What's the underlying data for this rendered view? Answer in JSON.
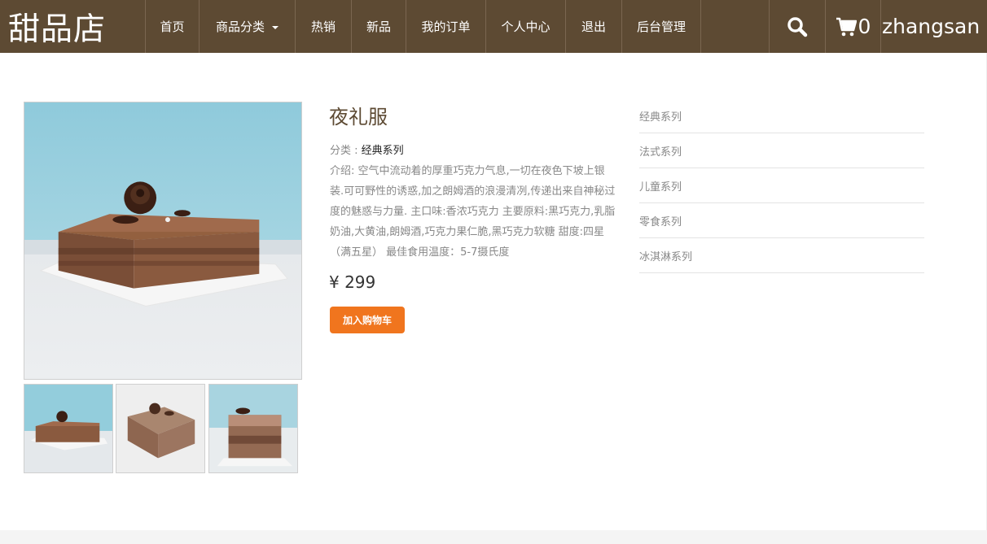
{
  "navbar": {
    "brand": "甜品店",
    "items": [
      {
        "label": "首页",
        "width": 66
      },
      {
        "label": "商品分类",
        "width": 118
      },
      {
        "label": "热销",
        "width": 69
      },
      {
        "label": "新品",
        "width": 67
      },
      {
        "label": "我的订单",
        "width": 98
      },
      {
        "label": "个人中心",
        "width": 98
      },
      {
        "label": "退出",
        "width": 69
      },
      {
        "label": "后台管理",
        "width": 97
      }
    ],
    "cart_count": "0",
    "username": "zhangsan",
    "icons": {
      "search": "search-icon",
      "cart": "cart-icon",
      "dropdown": "chevron-down-icon"
    }
  },
  "product": {
    "title": "夜礼服",
    "category_label": "分类 : ",
    "category_value": "经典系列",
    "description": "介绍: 空气中流动着的厚重巧克力气息,一切在夜色下坡上银装.可可野性的诱惑,加之朗姆酒的浪漫清冽,传递出来自神秘过度的魅惑与力量. 主口味:香浓巧克力 主要原料:黑巧克力,乳脂奶油,大黄油,朗姆酒,巧克力果仁脆,黑巧克力软糖 甜度:四星（满五星） 最佳食用温度：5-7摄氏度",
    "price": "¥ 299",
    "add_to_cart": "加入购物车"
  },
  "sidebar": {
    "items": [
      "经典系列",
      "法式系列",
      "儿童系列",
      "零食系列",
      "冰淇淋系列"
    ]
  },
  "colors": {
    "navbar": "#5d4a33",
    "accent": "#f0751e",
    "title": "#5d4a33"
  }
}
